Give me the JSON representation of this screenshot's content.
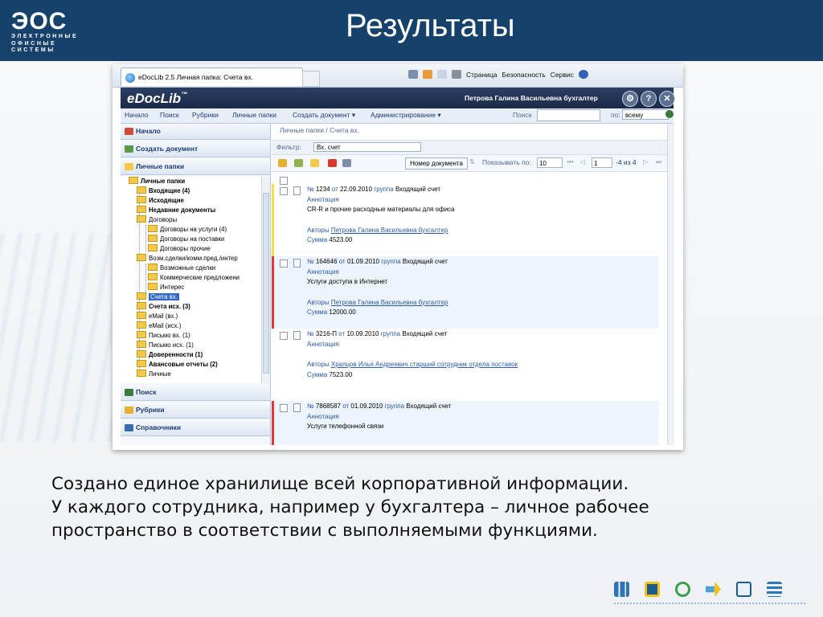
{
  "slide": {
    "logo_main": "ЭОС",
    "logo_sub": [
      "ЭЛЕКТРОННЫЕ",
      "ОФИСНЫЕ",
      "СИСТЕМЫ"
    ],
    "title": "Результаты",
    "caption": [
      "Создано единое хранилище всей корпоративной информации.",
      "У каждого сотрудника, например у бухгалтера  – личное рабочее",
      "пространство в соответствии с выполняемыми функциями."
    ],
    "colors": {
      "header": "#16416a",
      "accent": "#2a5aa6"
    }
  },
  "browser": {
    "tab_title": "eDocLib 2.5 Личная папка: Счета вх.",
    "commands": [
      "Страница",
      "Безопасность",
      "Сервис"
    ]
  },
  "app": {
    "logo": "eDocLib",
    "logo_tm": "™",
    "user": "Петрова Галина Васильевна бухгалтер",
    "header_buttons": [
      "settings-icon",
      "help-icon",
      "close-icon"
    ],
    "nav": [
      "Начало",
      "Поиск",
      "Рубрики",
      "Личные папки",
      "Создать документ ▾",
      "Администрирование ▾"
    ],
    "search_label": "Поиск",
    "scope_label": "по:",
    "scope_value": "всему"
  },
  "sidebar": {
    "top": [
      {
        "label": "Начало",
        "icon": "home-icon"
      },
      {
        "label": "Создать документ",
        "icon": "new-document-icon"
      },
      {
        "label": "Личные папки",
        "icon": "folder-icon"
      }
    ],
    "bottom": [
      {
        "label": "Поиск",
        "icon": "binoculars-icon"
      },
      {
        "label": "Рубрики",
        "icon": "rubric-icon"
      },
      {
        "label": "Справочники",
        "icon": "book-icon"
      }
    ],
    "tree": [
      {
        "label": "Личные папки",
        "bold": true
      },
      {
        "label": "Входящие (4)",
        "bold": true
      },
      {
        "label": "Исходящие",
        "bold": true
      },
      {
        "label": "Недавние документы",
        "bold": true
      },
      {
        "label": "Договоры",
        "bold": false
      },
      {
        "label": "Договоры на услуги (4)",
        "bold": false
      },
      {
        "label": "Договоры на поставки",
        "bold": false
      },
      {
        "label": "Договоры прочие",
        "bold": false
      },
      {
        "label": "Возм.сделки/комм.пред./интер",
        "bold": false
      },
      {
        "label": "Возможные сделки",
        "bold": false
      },
      {
        "label": "Коммерческие предложени",
        "bold": false
      },
      {
        "label": "Интерес",
        "bold": false
      },
      {
        "label": "Счета вх.",
        "bold": false,
        "selected": true
      },
      {
        "label": "Счета исх. (3)",
        "bold": true
      },
      {
        "label": "eMail (вх.)",
        "bold": false
      },
      {
        "label": "eMail (исх.)",
        "bold": false
      },
      {
        "label": "Письмо вх. (1)",
        "bold": false
      },
      {
        "label": "Письмо исх. (1)",
        "bold": false
      },
      {
        "label": "Доверенности (1)",
        "bold": true
      },
      {
        "label": "Авансовые отчеты (2)",
        "bold": true
      },
      {
        "label": "Личные",
        "bold": false
      }
    ]
  },
  "main": {
    "breadcrumb": "Личные папки / Счета вх.",
    "filter_label": "Фильтр:",
    "filter_value": "Вх. счет",
    "sort_field": "Номер документа",
    "show_label": "Показывать по:",
    "page_size": "10",
    "page": "1",
    "page_of": "-4 из 4",
    "field_labels": {
      "num": "№",
      "from": "от",
      "group": "группа",
      "annotation": "Аннотация",
      "authors": "Авторы",
      "sum": "Сумма"
    },
    "documents": [
      {
        "number": "1234",
        "date": "22.09.2010",
        "type": "Входящий счет",
        "description": "CR-R и прочие расходные материалы для офиса",
        "author": "Петрова Галина Васильевна бухгалтер",
        "sum": "4523.00",
        "mark_color": "#f0e14a"
      },
      {
        "number": "164646",
        "date": "01.09.2010",
        "type": "Входящий счет",
        "description": "Услуги доступа в Интернет",
        "author": "Петрова Галина Васильевна бухгалтер",
        "sum": "12000.00",
        "mark_color": "#e23a3a"
      },
      {
        "number": "3216-П",
        "date": "10.09.2010",
        "type": "Входящий счет",
        "description": "",
        "author": "Храпцов Илья Андреевич старший сотрудник отдела поставок",
        "sum": "7523.00",
        "mark_color": ""
      },
      {
        "number": "7868587",
        "date": "01.09.2010",
        "type": "Входящий счет",
        "description": "Услуги телефонной связи",
        "author": "",
        "sum": "",
        "mark_color": "#e23a3a"
      }
    ]
  },
  "footer_icons": [
    "chart-icon",
    "target-icon",
    "cycle-icon",
    "arrow-icon",
    "monitor-icon",
    "checklist-icon"
  ]
}
